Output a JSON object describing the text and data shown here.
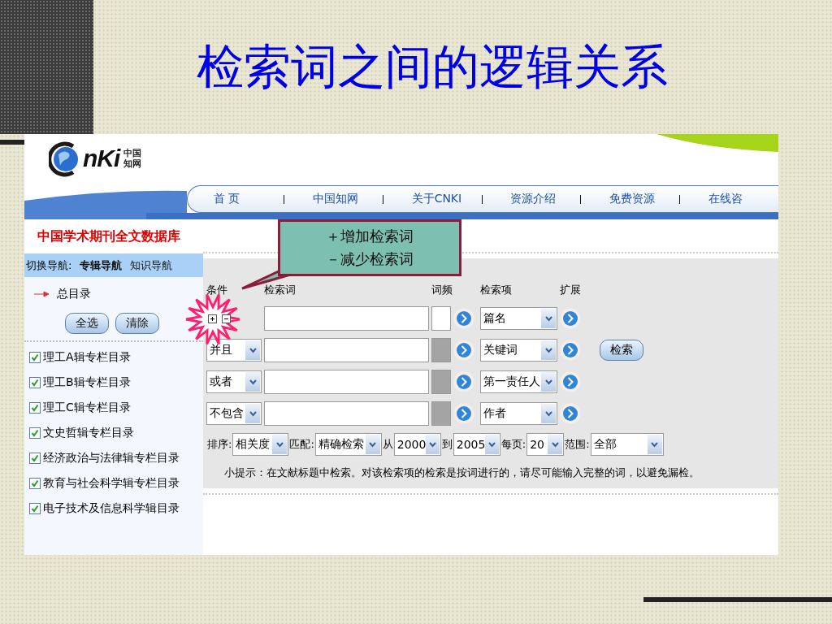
{
  "slide_title": "检索词之间的逻辑关系",
  "logo": {
    "mark": "nKi",
    "cn_top": "中国",
    "cn_bottom": "知网"
  },
  "nav": [
    {
      "label": "首 页"
    },
    {
      "label": "中国知网"
    },
    {
      "label": "关于CNKI"
    },
    {
      "label": "资源介绍"
    },
    {
      "label": "免费资源"
    },
    {
      "label": "在线咨"
    }
  ],
  "sidebar": {
    "title": "中国学术期刊全文数据库",
    "switch_label": "切换导航:",
    "switch_options": [
      {
        "label": "专辑导航",
        "selected": true
      },
      {
        "label": "知识导航",
        "selected": false
      }
    ],
    "root": "总目录",
    "buttons": [
      "全选",
      "清除"
    ],
    "items": [
      {
        "label": "理工A辑专栏目录",
        "checked": true
      },
      {
        "label": "理工B辑专栏目录",
        "checked": true
      },
      {
        "label": "理工C辑专栏目录",
        "checked": true
      },
      {
        "label": "文史哲辑专栏目录",
        "checked": true
      },
      {
        "label": "经济政治与法律辑专栏目录",
        "checked": true
      },
      {
        "label": "教育与社会科学辑专栏目录",
        "checked": true
      },
      {
        "label": "电子技术及信息科学辑目录",
        "checked": true
      }
    ]
  },
  "callout": {
    "lines": [
      "＋增加检索词",
      "－减少检索词"
    ]
  },
  "form": {
    "headers": [
      "条件",
      "检索词",
      "词频",
      "检索项",
      "扩展"
    ],
    "rows": [
      {
        "kind": "first",
        "freq_disabled": false,
        "field": "篇名"
      },
      {
        "kind": "logic",
        "condition": "并且",
        "freq_disabled": true,
        "field": "关键词"
      },
      {
        "kind": "logic",
        "condition": "或者",
        "freq_disabled": true,
        "field": "第一责任人"
      },
      {
        "kind": "logic",
        "condition": "不包含",
        "freq_disabled": true,
        "field": "作者"
      }
    ],
    "search_button": "检索",
    "options": [
      {
        "label": "排序:",
        "value": "相关度"
      },
      {
        "label": "匹配:",
        "value": "精确检索"
      },
      {
        "label": "从",
        "value": "2000"
      },
      {
        "label": "到",
        "value": "2005"
      },
      {
        "label": "每页:",
        "value": "20"
      },
      {
        "label": "范围:",
        "value": "全部"
      }
    ],
    "hint": "小提示：在文献标题中检索。对该检索项的检索是按词进行的，请尽可能输入完整的词，以避免漏检。"
  }
}
